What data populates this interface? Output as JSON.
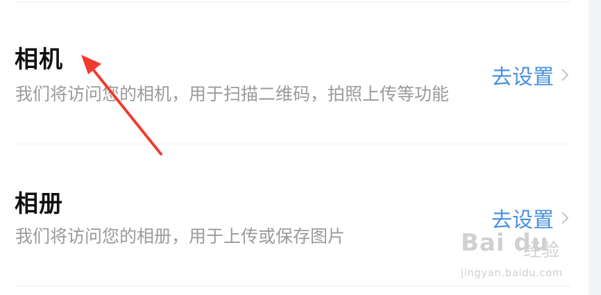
{
  "permissions": [
    {
      "title": "相机",
      "description": "我们将访问您的相机，用于扫描二维码，拍照上传等功能",
      "action_label": "去设置"
    },
    {
      "title": "相册",
      "description": "我们将访问您的相册，用于上传或保存图片",
      "action_label": "去设置"
    }
  ],
  "annotation": {
    "arrow_color": "#f03a2e"
  },
  "watermark": {
    "brand": "Bai du",
    "sub": "经验",
    "url": "jingyan.baidu.com"
  },
  "colors": {
    "title": "#111111",
    "description": "#9a9a9a",
    "link": "#4a90e2",
    "divider": "#eeeeee"
  }
}
